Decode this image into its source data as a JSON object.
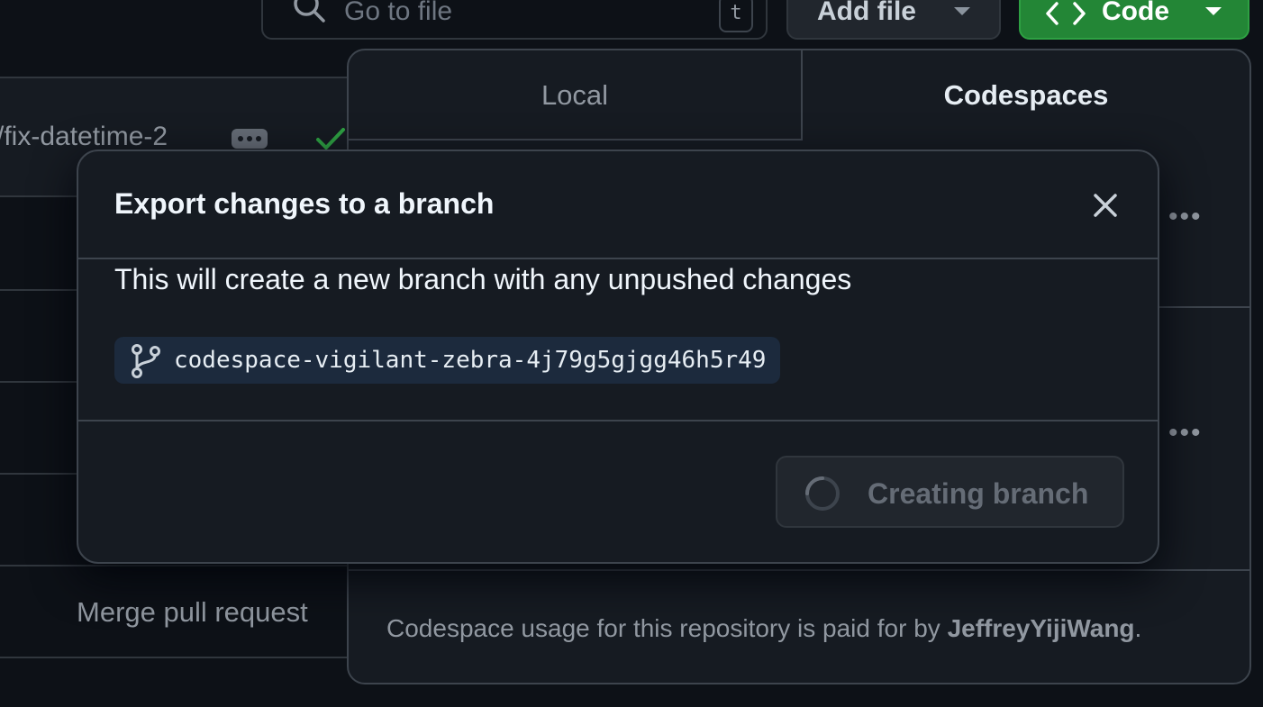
{
  "toolbar": {
    "search_placeholder": "Go to file",
    "search_shortcut": "t",
    "add_file_label": "Add file",
    "code_label": "Code"
  },
  "file_list": {
    "branch_fragment": "/fix-datetime-2",
    "merge_commit_text": "Merge pull request"
  },
  "code_panel": {
    "tabs": [
      {
        "label": "Local",
        "active": false
      },
      {
        "label": "Codespaces",
        "active": true
      }
    ],
    "row_menu_glyph": "•••",
    "footer_prefix": "Codespace usage for this repository is paid for by ",
    "footer_owner": "JeffreyYijiWang",
    "footer_suffix": "."
  },
  "modal": {
    "title": "Export changes to a branch",
    "description": "This will create a new branch with any unpushed changes",
    "branch_name": "codespace-vigilant-zebra-4j79g5gjgg46h5r49",
    "submit_label": "Creating branch",
    "submit_state": "loading"
  },
  "colors": {
    "background": "#0d1117",
    "surface": "#161b22",
    "border": "#3d444d",
    "primary_green": "#238636",
    "success_check": "#2ea043",
    "branch_chip_bg": "#1c2a3d"
  }
}
